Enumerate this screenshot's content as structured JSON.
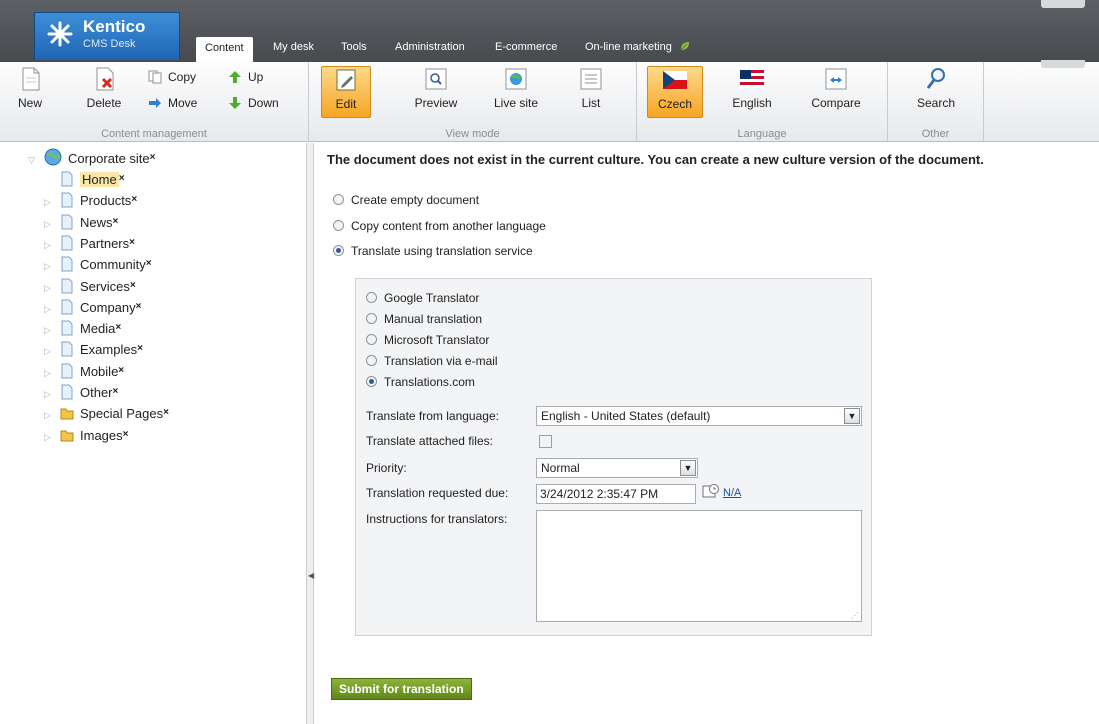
{
  "app": {
    "brand": "Kentico",
    "subtitle": "CMS Desk"
  },
  "nav": {
    "tabs": [
      {
        "label": "Content",
        "active": true
      },
      {
        "label": "My desk"
      },
      {
        "label": "Tools"
      },
      {
        "label": "Administration"
      },
      {
        "label": "E-commerce"
      },
      {
        "label": "On-line marketing"
      }
    ]
  },
  "ribbon": {
    "content_management": {
      "title": "Content management",
      "new": "New",
      "delete": "Delete",
      "copy": "Copy",
      "move": "Move",
      "up": "Up",
      "down": "Down"
    },
    "view_mode": {
      "title": "View mode",
      "edit": "Edit",
      "preview": "Preview",
      "live_site": "Live site",
      "list": "List",
      "selected": "Edit"
    },
    "language": {
      "title": "Language",
      "czech": "Czech",
      "english": "English",
      "compare": "Compare",
      "selected": "Czech"
    },
    "other": {
      "title": "Other",
      "search": "Search"
    }
  },
  "tree": {
    "root": "Corporate site",
    "items": [
      "Home",
      "Products",
      "News",
      "Partners",
      "Community",
      "Services",
      "Company",
      "Media",
      "Examples",
      "Mobile",
      "Other",
      "Special Pages",
      "Images"
    ],
    "selected": "Home",
    "close_mark": "×"
  },
  "main": {
    "headline": "The document does not exist in the current culture. You can create a new culture version of the document.",
    "options": [
      {
        "label": "Create empty document",
        "checked": false
      },
      {
        "label": "Copy content from another language",
        "checked": false
      },
      {
        "label": "Translate using translation service",
        "checked": true
      }
    ],
    "services": [
      {
        "label": "Google Translator",
        "checked": false
      },
      {
        "label": "Manual translation",
        "checked": false
      },
      {
        "label": "Microsoft Translator",
        "checked": false
      },
      {
        "label": "Translation via e-mail",
        "checked": false
      },
      {
        "label": "Translations.com",
        "checked": true
      }
    ],
    "form": {
      "from_language_label": "Translate from language:",
      "from_language_value": "English - United States (default)",
      "attached_files_label": "Translate attached files:",
      "attached_files_checked": false,
      "priority_label": "Priority:",
      "priority_value": "Normal",
      "due_label": "Translation requested due:",
      "due_value": "3/24/2012 2:35:47 PM",
      "due_na": "N/A",
      "instructions_label": "Instructions for translators:",
      "instructions_value": ""
    },
    "submit": "Submit for translation"
  },
  "colors": {
    "header": "#4f5256",
    "selected_orange": "#f6a524",
    "tree_selected": "#fbe6a8",
    "submit_green": "#6f9a20",
    "link_blue": "#1a4fa8"
  }
}
